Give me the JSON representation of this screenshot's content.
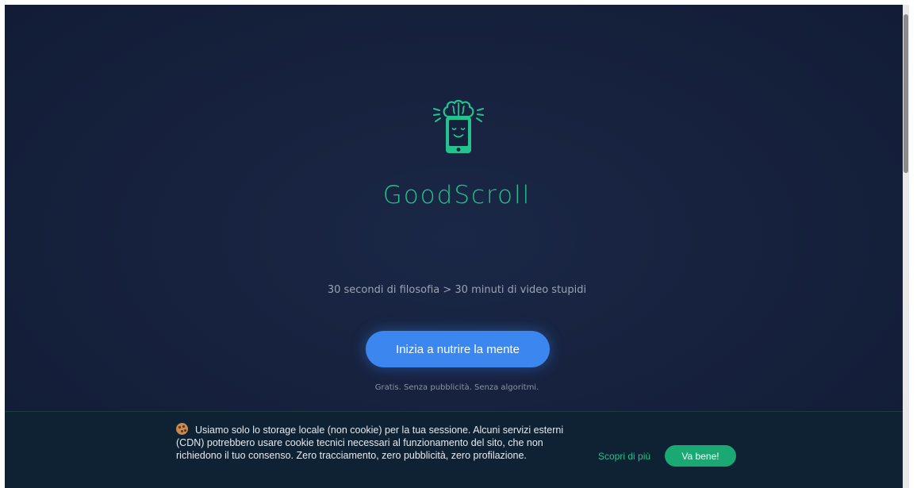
{
  "brand": {
    "name": "GoodScroll",
    "logo_icon": "brain-smartphone-icon",
    "color": "#22c38e"
  },
  "hero": {
    "tagline": "30 secondi di filosofia > 30 minuti di video stupidi",
    "cta_label": "Inizia a nutrire la mente",
    "cta_color": "#3b86ef",
    "note": "Gratis. Senza pubblicità. Senza algoritmi."
  },
  "cookie_banner": {
    "icon": "cookie-icon",
    "text": "Usiamo solo lo storage locale (non cookie) per la tua sessione. Alcuni servizi esterni (CDN) potrebbero usare cookie tecnici necessari al funzionamento del sito, che non richiedono il tuo consenso. Zero tracciamento, zero pubblicità, zero profilazione.",
    "learn_more_label": "Scopri di più",
    "accept_label": "Va bene!",
    "accept_color": "#1aa873"
  },
  "colors": {
    "background": "#16213d",
    "banner_background": "#0f2233"
  }
}
